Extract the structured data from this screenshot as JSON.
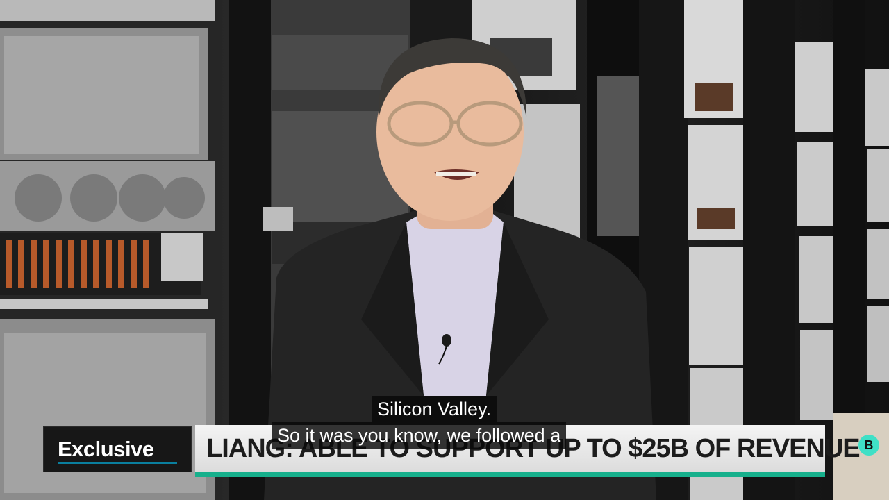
{
  "lower_third": {
    "tag": "Exclusive",
    "headline": "LIANG: ABLE TO SUPPORT UP TO $25B OF REVENUE"
  },
  "captions": {
    "line1": "Silicon Valley.",
    "line2": "So it was you know, we followed a"
  },
  "channel_badge": {
    "letter": "B"
  },
  "colors": {
    "accent": "#17b08c",
    "exclusive_rule": "#0a7f9e",
    "badge": "#3fe0c6"
  },
  "icons": [
    "microphone-icon",
    "channel-logo-icon"
  ]
}
